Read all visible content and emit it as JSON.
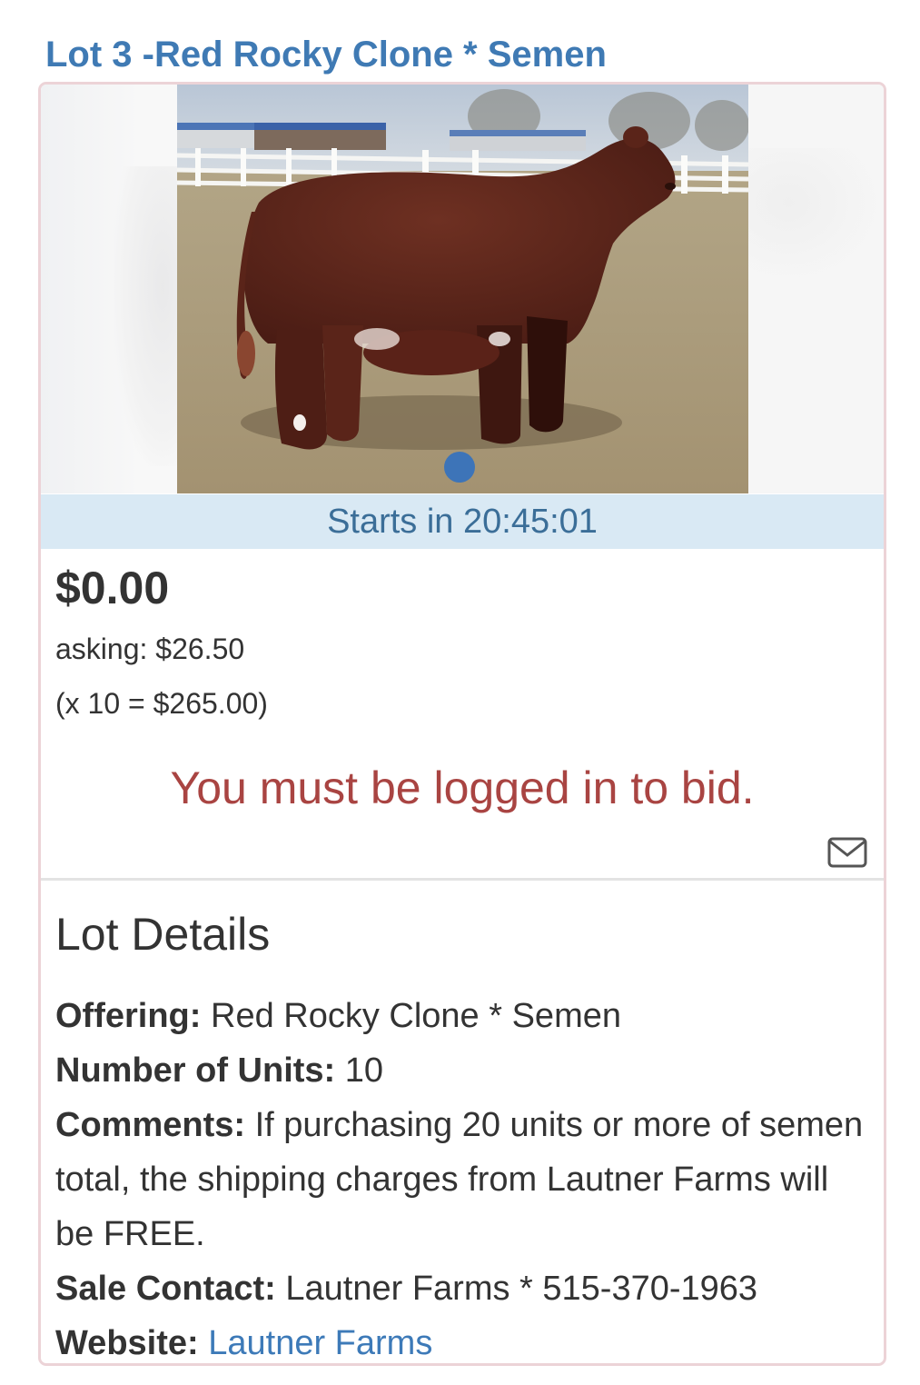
{
  "lot": {
    "title": "Lot 3 -Red Rocky Clone * Semen",
    "carousel": {
      "slide_count": 1,
      "active_slide": 1,
      "accent_color": "#3d74b8"
    },
    "timer_text": "Starts in 20:45:01",
    "current_bid": "$0.00",
    "asking_text": "asking: $26.50",
    "total_text": "(x 10 = $265.00)",
    "login_message": "You must be logged in to bid.",
    "mail_icon": "envelope-icon"
  },
  "details": {
    "heading": "Lot Details",
    "offering_label": "Offering:",
    "offering_value": "Red Rocky Clone * Semen",
    "units_label": "Number of Units:",
    "units_value": "10",
    "comments_label": "Comments:",
    "comments_value": "If purchasing 20 units or more of semen total, the shipping charges from Lautner Farms will be FREE.",
    "contact_label": "Sale Contact:",
    "contact_value": "Lautner Farms * 515-370-1963",
    "website_label": "Website:",
    "website_value": "Lautner Farms"
  },
  "colors": {
    "title": "#3f7ab4",
    "timer_bg": "#d9e9f4",
    "error": "#a94442",
    "link": "#3d7ab8",
    "card_border": "#ecd3d7"
  }
}
